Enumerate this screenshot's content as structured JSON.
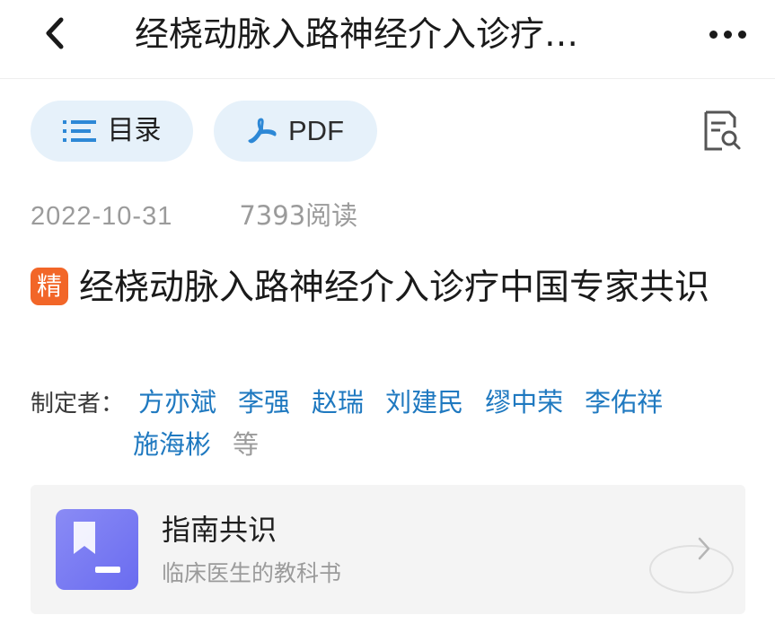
{
  "nav": {
    "title": "经桡动脉入路神经介入诊疗…",
    "back_icon": "chevron-left-icon",
    "more_icon": "more-horizontal-icon"
  },
  "toolbar": {
    "toc_label": "目录",
    "toc_icon": "list-icon",
    "pdf_label": "PDF",
    "pdf_icon": "acrobat-icon",
    "search_doc_icon": "document-search-icon",
    "accent_color": "#e6f1fa"
  },
  "meta": {
    "date": "2022-10-31",
    "reads": "7393阅读"
  },
  "article": {
    "badge": "精",
    "badge_color": "#f26628",
    "title": "经桡动脉入路神经介入诊疗中国专家共识"
  },
  "authors": {
    "label": "制定者：",
    "names": [
      "方亦斌",
      "李强",
      "赵瑞",
      "刘建民",
      "缪中荣",
      "李佑祥",
      "施海彬"
    ],
    "etc": "等",
    "link_color": "#1f79c0"
  },
  "card": {
    "title": "指南共识",
    "subtitle": "临床医生的教科书",
    "icon": "bookmark-icon",
    "chevron_icon": "chevron-right-icon"
  }
}
